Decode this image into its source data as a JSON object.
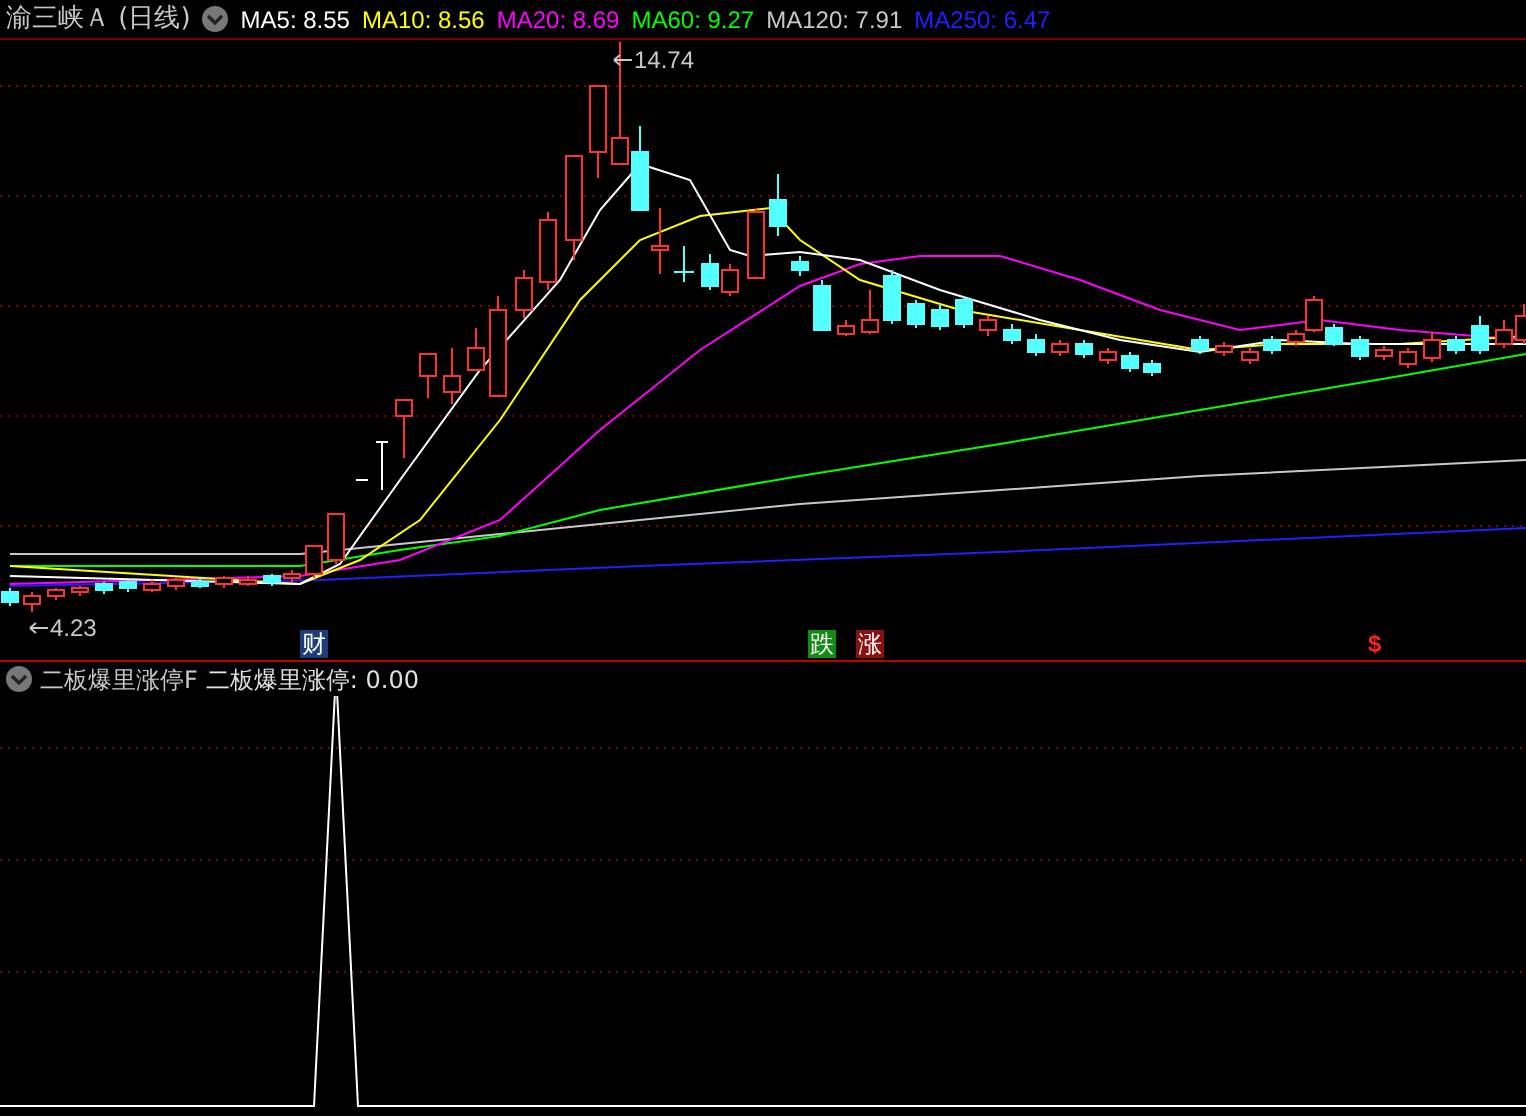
{
  "header": {
    "title": "渝三峡Ａ (日线)",
    "indicators": [
      {
        "label": "MA5: 8.55",
        "color": "#ffffff"
      },
      {
        "label": "MA10: 8.56",
        "color": "#ffff00"
      },
      {
        "label": "MA20: 8.69",
        "color": "#ff00ff"
      },
      {
        "label": "MA60: 9.27",
        "color": "#00ff00"
      },
      {
        "label": "MA120: 7.91",
        "color": "#c8c8c8"
      },
      {
        "label": "MA250: 6.47",
        "color": "#2020ff"
      }
    ]
  },
  "chart": {
    "high_label": "14.74",
    "low_label": "4.23",
    "markers": [
      {
        "kind": "badge",
        "text": "财",
        "color": "#1c3f7a"
      },
      {
        "kind": "badge",
        "text": "跌",
        "color": "#138a13"
      },
      {
        "kind": "badge",
        "text": "涨",
        "color": "#8b1010"
      },
      {
        "kind": "sign",
        "text": "$",
        "color": "#ff2020"
      }
    ]
  },
  "sub_panel": {
    "title": "二板爆里涨停F",
    "reading": "二板爆里涨停: 0.00"
  }
}
